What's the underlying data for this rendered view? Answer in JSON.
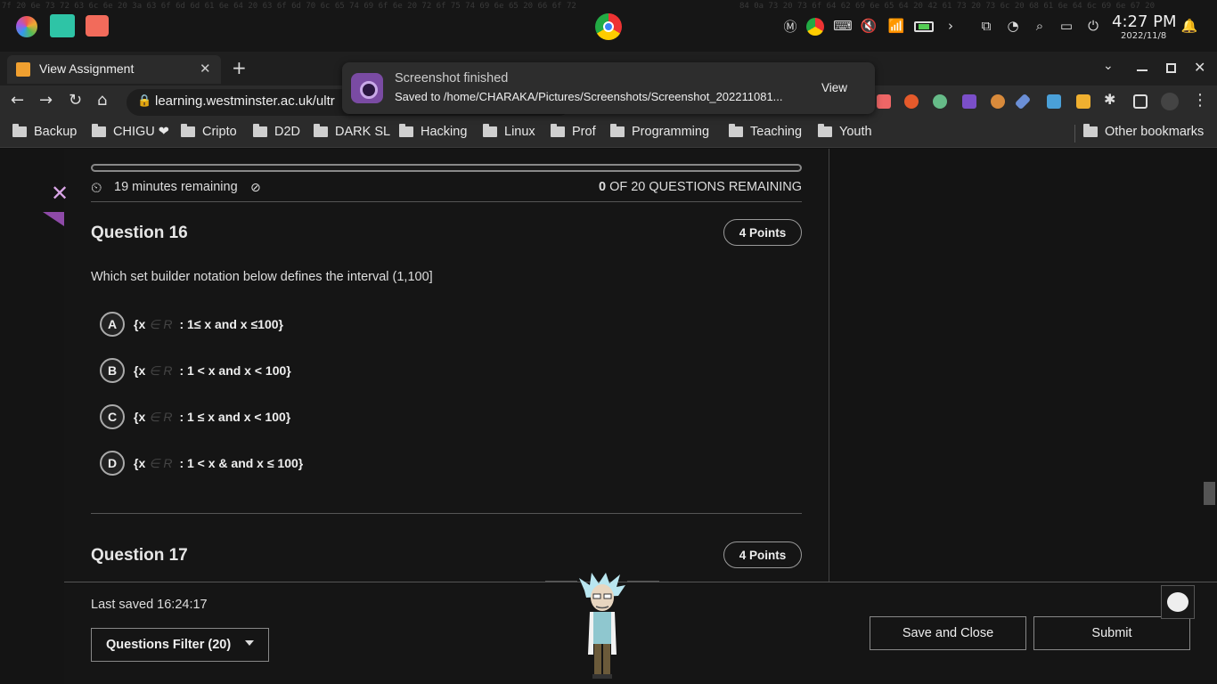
{
  "system": {
    "time": "4:27 PM",
    "date": "2022/11/8"
  },
  "browser": {
    "tab_title": "View Assignment",
    "url": "learning.westminster.ac.uk/ultr",
    "bookmarks": [
      "Backup",
      "CHIGU ❤",
      "Cripto",
      "D2D",
      "DARK SL",
      "Hacking",
      "Linux",
      "Prof",
      "Programming",
      "Teaching",
      "Youth"
    ],
    "other_bookmarks": "Other bookmarks"
  },
  "notification": {
    "title": "Screenshot finished",
    "body": "Saved to /home/CHARAKA/Pictures/Screenshots/Screenshot_202211081...",
    "action": "View"
  },
  "assessment": {
    "timer": "19 minutes remaining",
    "remaining_count": "0",
    "remaining_label": "OF 20 QUESTIONS REMAINING",
    "progress": 1.0,
    "question16": {
      "title": "Question 16",
      "points": "4 Points",
      "text": "Which set builder notation below defines the interval (1,100]",
      "options": [
        {
          "letter": "A",
          "prefix": "{x",
          "elem": "∈ R",
          "rest": ": 1≤ x and x ≤100}"
        },
        {
          "letter": "B",
          "prefix": "{x",
          "elem": "∈ R",
          "rest": ": 1 < x and x < 100}"
        },
        {
          "letter": "C",
          "prefix": "{x",
          "elem": "∈ R",
          "rest": ": 1 ≤ x and x < 100}"
        },
        {
          "letter": "D",
          "prefix": "{x",
          "elem": "∈ R",
          "rest": ": 1 < x & and x ≤ 100}"
        }
      ]
    },
    "question17": {
      "title": "Question 17",
      "points": "4 Points"
    }
  },
  "footer": {
    "last_saved": "Last saved 16:24:17",
    "questions_filter": "Questions Filter (20)",
    "save_close": "Save and Close",
    "submit": "Submit"
  },
  "colors": {
    "accent_purple": "#8e4aa8",
    "close_x": "#d9a5e6"
  }
}
